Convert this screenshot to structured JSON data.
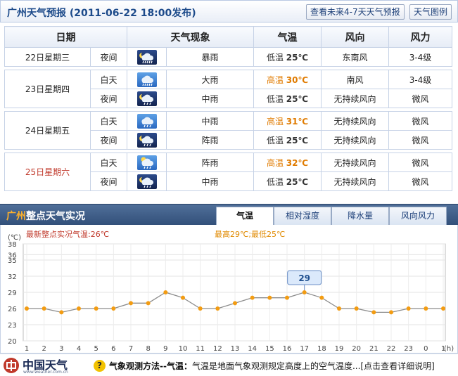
{
  "header": {
    "title": "广州天气预报 (2011-06-22  18:00发布)",
    "btn_future": "查看未来4-7天天气预报",
    "btn_legend": "天气图例"
  },
  "table": {
    "headers": [
      "日期",
      "天气现象",
      "气温",
      "风向",
      "风力"
    ],
    "days": [
      {
        "date": "22日星期三",
        "weekend": false,
        "rows": [
          {
            "period": "夜间",
            "icon": "heavy-rain-night-icon",
            "night": true,
            "weather": "暴雨",
            "temp_label": "低温",
            "temp": "25℃",
            "hot": false,
            "wind_dir": "东南风",
            "wind_force": "3-4级"
          }
        ]
      },
      {
        "date": "23日星期四",
        "weekend": false,
        "rows": [
          {
            "period": "白天",
            "icon": "heavy-rain-day-icon",
            "night": false,
            "weather": "大雨",
            "temp_label": "高温",
            "temp": "30℃",
            "hot": true,
            "wind_dir": "南风",
            "wind_force": "3-4级"
          },
          {
            "period": "夜间",
            "icon": "moderate-rain-night-icon",
            "night": true,
            "weather": "中雨",
            "temp_label": "低温",
            "temp": "25℃",
            "hot": false,
            "wind_dir": "无持续风向",
            "wind_force": "微风"
          }
        ]
      },
      {
        "date": "24日星期五",
        "weekend": false,
        "rows": [
          {
            "period": "白天",
            "icon": "moderate-rain-day-icon",
            "night": false,
            "weather": "中雨",
            "temp_label": "高温",
            "temp": "31℃",
            "hot": true,
            "wind_dir": "无持续风向",
            "wind_force": "微风"
          },
          {
            "period": "夜间",
            "icon": "shower-night-icon",
            "night": true,
            "weather": "阵雨",
            "temp_label": "低温",
            "temp": "25℃",
            "hot": false,
            "wind_dir": "无持续风向",
            "wind_force": "微风"
          }
        ]
      },
      {
        "date": "25日星期六",
        "weekend": true,
        "rows": [
          {
            "period": "白天",
            "icon": "shower-day-icon",
            "night": false,
            "weather": "阵雨",
            "temp_label": "高温",
            "temp": "32℃",
            "hot": true,
            "wind_dir": "无持续风向",
            "wind_force": "微风"
          },
          {
            "period": "夜间",
            "icon": "moderate-rain-night-icon",
            "night": true,
            "weather": "中雨",
            "temp_label": "低温",
            "temp": "25℃",
            "hot": false,
            "wind_dir": "无持续风向",
            "wind_force": "微风"
          }
        ]
      }
    ]
  },
  "live": {
    "city": "广州",
    "title_suffix": "整点天气实况",
    "tabs": [
      "气温",
      "相对湿度",
      "降水量",
      "风向风力"
    ],
    "active_tab": 0
  },
  "chart_data": {
    "type": "line",
    "unit_label": "(℃)",
    "x_unit_label": "(h)",
    "latest_label": "最新整点实况气温:26℃",
    "range_label": "最高29℃;最低25℃",
    "highlight_value": "29",
    "x": [
      "1",
      "2",
      "3",
      "4",
      "5",
      "6",
      "7",
      "8",
      "9",
      "10",
      "11",
      "12",
      "13",
      "14",
      "15",
      "16",
      "17",
      "18",
      "19",
      "20",
      "21",
      "22",
      "23",
      "0",
      "1"
    ],
    "values": [
      26,
      26,
      25.3,
      26,
      26,
      26,
      27,
      27,
      29,
      28,
      26,
      26,
      27,
      28,
      28,
      28,
      29,
      28,
      26,
      26,
      25.3,
      25.3,
      26,
      26,
      26
    ],
    "yticks": [
      20,
      23,
      26,
      29,
      32,
      35,
      38,
      36
    ],
    "ylim": [
      20,
      38
    ],
    "grid": true,
    "line_color": "#8c8c8c",
    "point_color": "#f39c12",
    "latest_color": "#c0392b",
    "range_color": "#e08a00",
    "callout_color": "#1f4f8f"
  },
  "footer": {
    "logo": "中国天气",
    "logo_sub": "www.weather.com.cn",
    "help_icon": "question-icon",
    "help_title": "气象观测方法--气温：",
    "help_body": "气温是地面气象观测规定高度上的空气温度...",
    "help_link": "[点击查看详细说明]"
  },
  "colors": {
    "header_text": "#1c4a8a",
    "live_bar": "#3d5c86",
    "city": "#ffb12a",
    "weekend": "#c0392b",
    "hot_temp": "#e07b00"
  }
}
